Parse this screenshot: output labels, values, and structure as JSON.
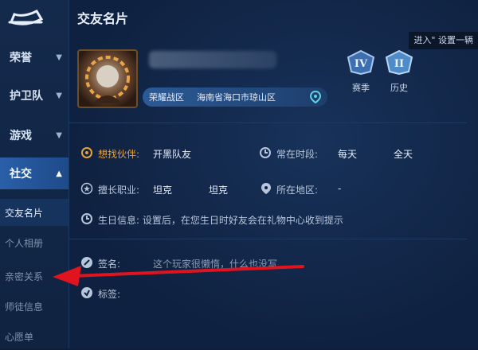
{
  "sidebar": {
    "items": [
      {
        "label": "荣誉"
      },
      {
        "label": "护卫队"
      },
      {
        "label": "游戏"
      },
      {
        "label": "社交"
      }
    ],
    "sub_items": [
      {
        "label": "交友名片"
      },
      {
        "label": "个人相册"
      },
      {
        "label": "亲密关系"
      },
      {
        "label": "师徒信息"
      },
      {
        "label": "心愿单"
      }
    ]
  },
  "header": {
    "title": "交友名片",
    "tip": "进入\" 设置一辆"
  },
  "profile": {
    "zone": "荣耀战区",
    "region": "海南省海口市琼山区",
    "badges": [
      {
        "label": "赛季",
        "roman": "IV"
      },
      {
        "label": "历史",
        "roman": "II"
      }
    ]
  },
  "fields": {
    "partner_label": "想找伙伴:",
    "partner_value": "开黑队友",
    "online_label": "常在时段:",
    "online_value1": "每天",
    "online_value2": "全天",
    "role_label": "擅长职业:",
    "role_value1": "坦克",
    "role_value2": "坦克",
    "area_label": "所在地区:",
    "area_value": "-",
    "birthday": "生日信息: 设置后，在您生日时好友会在礼物中心收到提示",
    "signature_label": "签名:",
    "signature_value": "这个玩家很懒惰，什么也没写",
    "tags_label": "标签:"
  },
  "colors": {
    "accent": "#e9a13b",
    "arrow": "#e0141e",
    "active_nav": "#2a5fa8"
  }
}
